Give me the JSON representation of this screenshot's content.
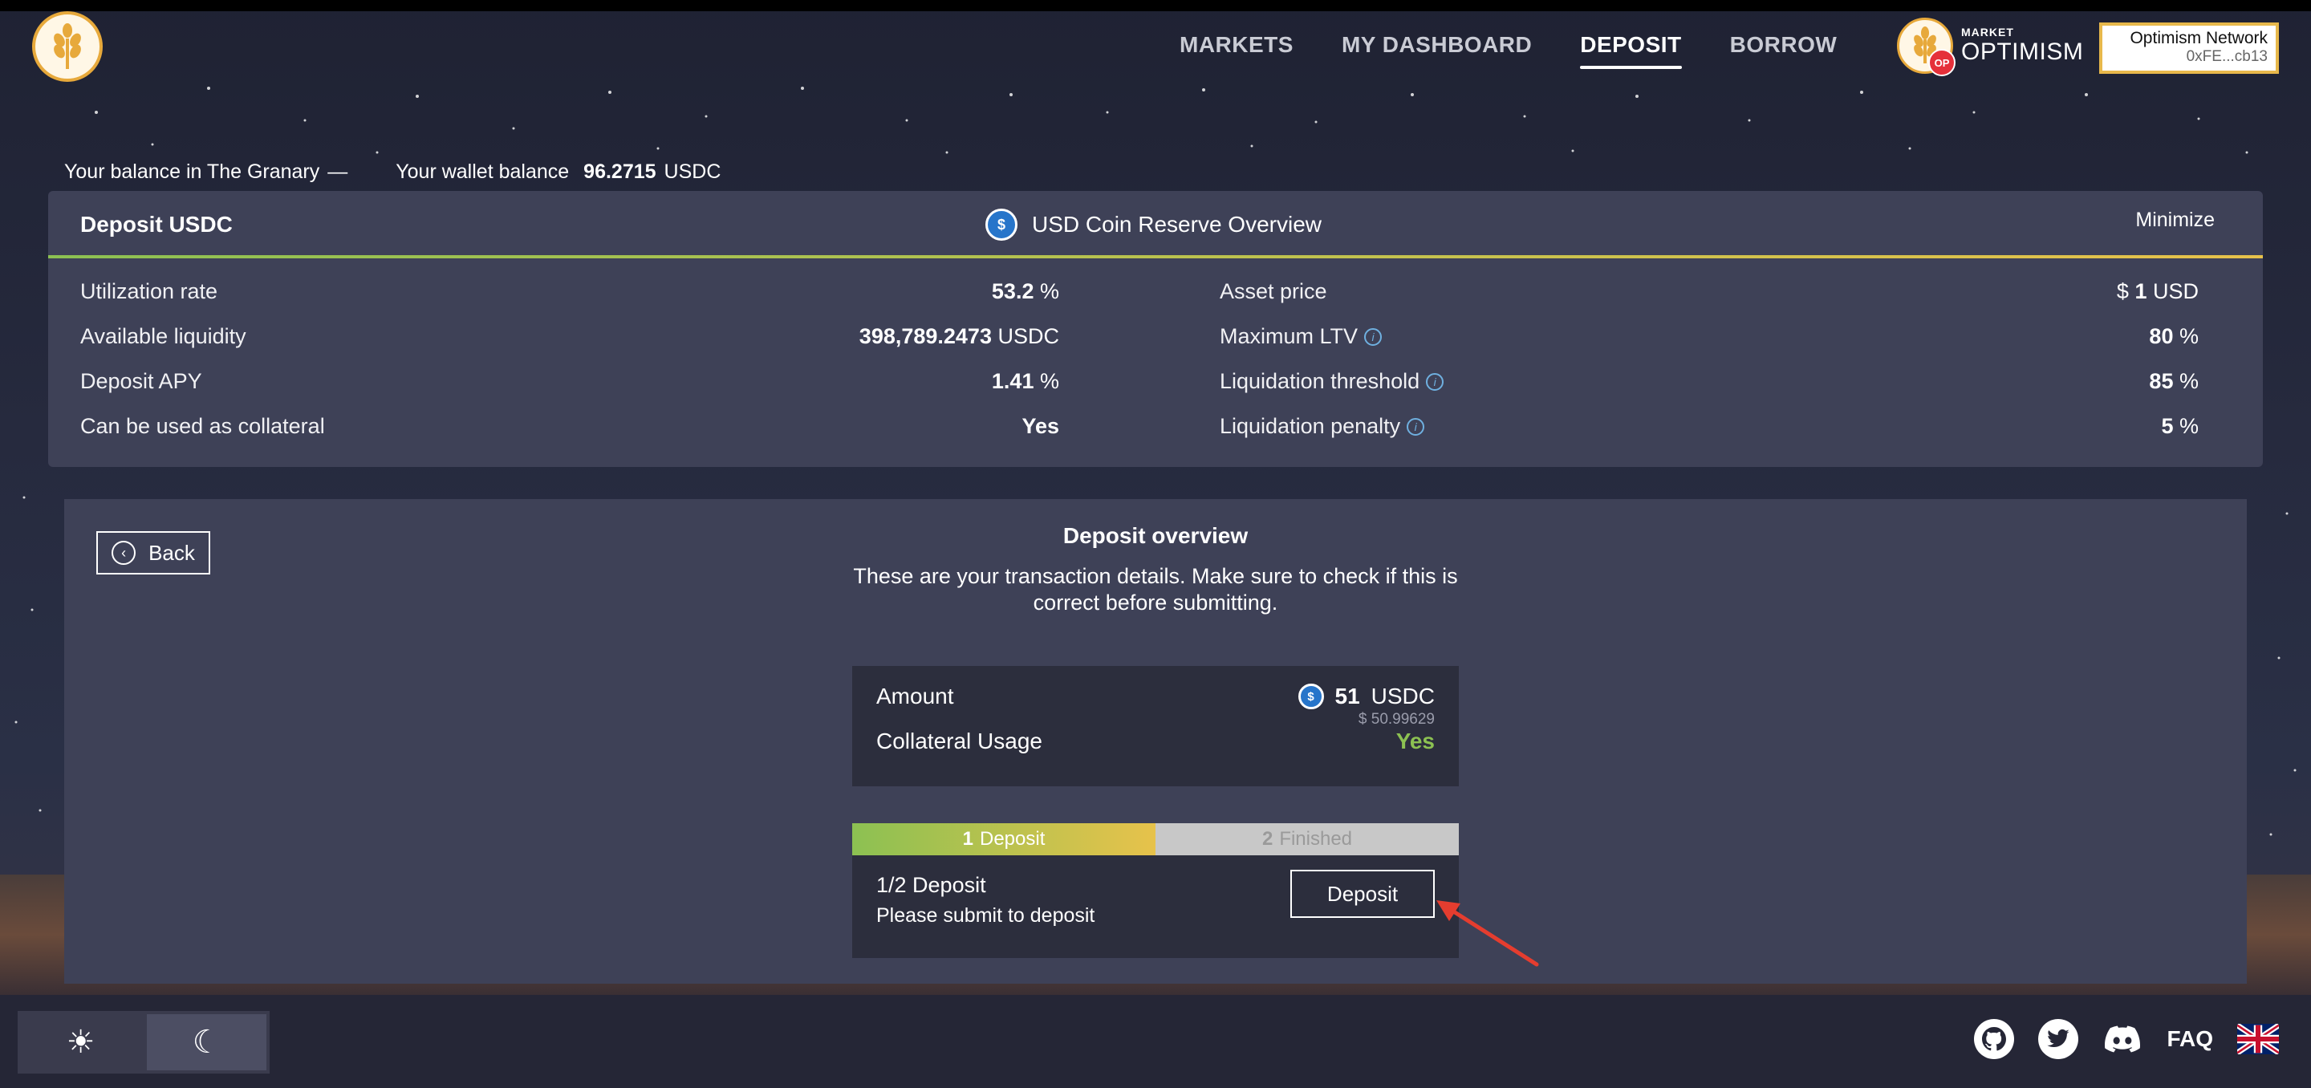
{
  "nav": {
    "items": [
      {
        "label": "MARKETS",
        "active": false
      },
      {
        "label": "MY DASHBOARD",
        "active": false
      },
      {
        "label": "DEPOSIT",
        "active": true
      },
      {
        "label": "BORROW",
        "active": false
      }
    ]
  },
  "market": {
    "small": "MARKET",
    "name": "OPTIMISM",
    "badge": "OP"
  },
  "network": {
    "name": "Optimism Network",
    "address": "0xFE...cb13"
  },
  "balances": {
    "granary_label": "Your balance in The Granary",
    "granary_value": "—",
    "wallet_label": "Your wallet balance",
    "wallet_value": "96.2715",
    "wallet_unit": "USDC"
  },
  "reserve": {
    "title": "Deposit USDC",
    "overview_title": "USD Coin Reserve Overview",
    "minimize": "Minimize",
    "left": [
      {
        "label": "Utilization rate",
        "value": "53.2",
        "unit": "%"
      },
      {
        "label": "Available liquidity",
        "value": "398,789.2473",
        "unit": "USDC"
      },
      {
        "label": "Deposit APY",
        "value": "1.41",
        "unit": "%"
      },
      {
        "label": "Can be used as collateral",
        "value": "Yes",
        "unit": ""
      }
    ],
    "right": [
      {
        "label": "Asset price",
        "prefix": "$",
        "value": "1",
        "unit": "USD",
        "info": false
      },
      {
        "label": "Maximum LTV",
        "prefix": "",
        "value": "80",
        "unit": "%",
        "info": true
      },
      {
        "label": "Liquidation threshold",
        "prefix": "",
        "value": "85",
        "unit": "%",
        "info": true
      },
      {
        "label": "Liquidation penalty",
        "prefix": "",
        "value": "5",
        "unit": "%",
        "info": true
      }
    ]
  },
  "overview": {
    "back": "Back",
    "title": "Deposit overview",
    "description": "These are your transaction details. Make sure to check if this is correct before submitting.",
    "amount_label": "Amount",
    "amount_value": "51",
    "amount_unit": "USDC",
    "amount_usd": "$ 50.99629",
    "collateral_label": "Collateral Usage",
    "collateral_value": "Yes"
  },
  "steps": {
    "step1_num": "1",
    "step1_label": "Deposit",
    "step2_num": "2",
    "step2_label": "Finished",
    "current_title": "1/2 Deposit",
    "current_sub": "Please submit to deposit",
    "button": "Deposit"
  },
  "footer": {
    "faq": "FAQ"
  },
  "colors": {
    "accent_green": "#8cc152",
    "accent_yellow": "#e7c24b",
    "arrow_red": "#e53d2f",
    "panel": "#3e4157"
  },
  "icons": [
    "logo-wheat-icon",
    "usdc-icon",
    "info-icon",
    "back-circle-icon",
    "sun-icon",
    "moon-icon",
    "github-icon",
    "twitter-icon",
    "discord-icon",
    "uk-flag-icon"
  ]
}
